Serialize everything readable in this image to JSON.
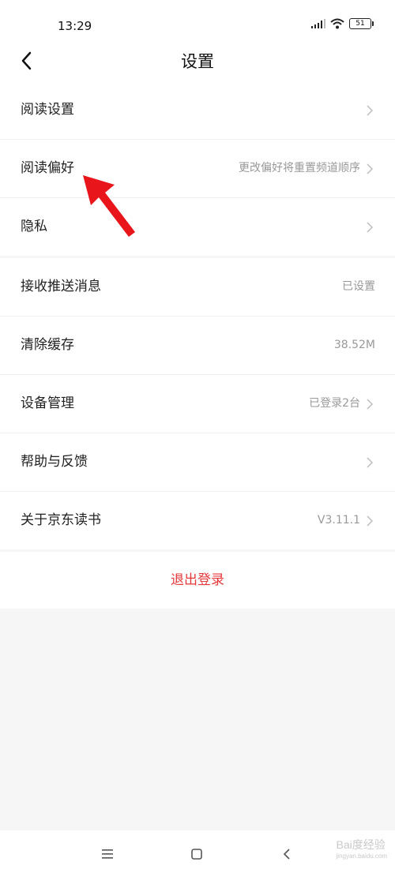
{
  "status": {
    "time": "13:29",
    "battery": "51"
  },
  "header": {
    "title": "设置"
  },
  "group1": [
    {
      "label": "阅读设置",
      "value": ""
    },
    {
      "label": "阅读偏好",
      "value": "更改偏好将重置频道顺序"
    },
    {
      "label": "隐私",
      "value": ""
    }
  ],
  "group2": [
    {
      "label": "接收推送消息",
      "value": "已设置"
    },
    {
      "label": "清除缓存",
      "value": "38.52M"
    },
    {
      "label": "设备管理",
      "value": "已登录2台"
    },
    {
      "label": "帮助与反馈",
      "value": ""
    },
    {
      "label": "关于京东读书",
      "value": "V3.11.1"
    }
  ],
  "logout_label": "退出登录",
  "watermark": {
    "main": "Bai度经验",
    "sub": "jingyan.baidu.com"
  },
  "colors": {
    "accent": "#e5383b",
    "annotation_arrow": "#e8151b"
  }
}
